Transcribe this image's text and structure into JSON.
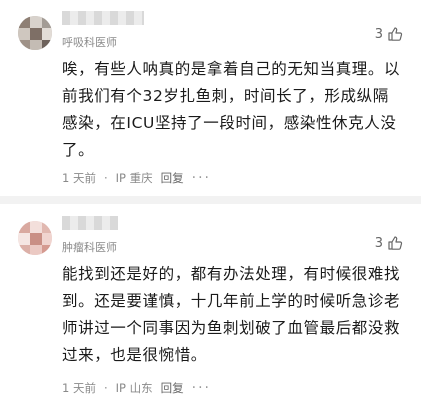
{
  "comments": [
    {
      "role": "呼吸科医师",
      "likes": "3",
      "text": "唉，有些人呐真的是拿着自己的无知当真理。以前我们有个32岁扎鱼刺，时间长了，形成纵隔感染，在ICU坚持了一段时间，感染性休克人没了。",
      "time": "1 天前",
      "location": "IP 重庆",
      "reply": "回复",
      "more": "···"
    },
    {
      "role": "肿瘤科医师",
      "likes": "3",
      "text": "能找到还是好的，都有办法处理，有时候很难找到。还是要谨慎，十几年前上学的时候听急诊老师讲过一个同事因为鱼刺划破了血管最后都没救过来，也是很惋惜。",
      "time": "1 天前",
      "location": "IP 山东",
      "reply": "回复",
      "more": "···"
    }
  ],
  "colors": {
    "text": "#1a1a1a",
    "secondary": "#8a8a8a",
    "divider": "#f2f2f2"
  }
}
